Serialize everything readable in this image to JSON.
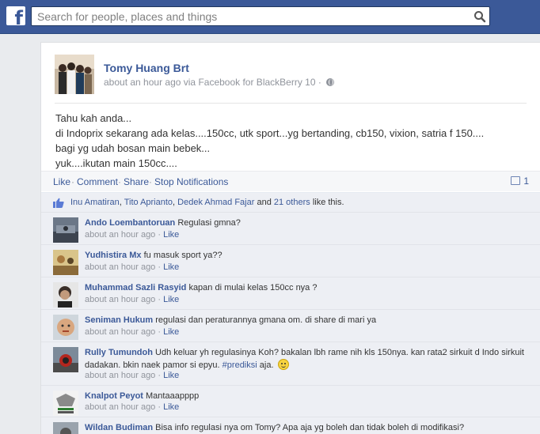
{
  "header": {
    "search_placeholder": "Search for people, places and things"
  },
  "post": {
    "author": "Tomy Huang Brt",
    "time": "about an hour ago",
    "via": "via Facebook for BlackBerry 10",
    "lines": [
      "Tahu kah anda...",
      "di Indoprix sekarang ada kelas....150cc, utk sport...yg bertanding, cb150, vixion, satria f 150....",
      "bagi yg udah bosan main bebek...",
      "yuk....ikutan main 150cc...."
    ]
  },
  "actions": {
    "like": "Like",
    "comment": "Comment",
    "share": "Share",
    "stop": "Stop Notifications",
    "comment_count": "1"
  },
  "likes": {
    "names": [
      "Inu Amatiran",
      "Tito Aprianto",
      "Dedek Ahmad Fajar"
    ],
    "and": "and",
    "others": "21 others",
    "suffix": "like this."
  },
  "comments": [
    {
      "name": "Ando Loembantoruan",
      "text": "Regulasi gmna?",
      "time": "about an hour ago",
      "like": "Like"
    },
    {
      "name": "Yudhistira Mx",
      "text": "fu masuk sport ya??",
      "time": "about an hour ago",
      "like": "Like"
    },
    {
      "name": "Muhammad Sazli Rasyid",
      "text": "kapan di mulai kelas 150cc nya ?",
      "time": "about an hour ago",
      "like": "Like"
    },
    {
      "name": "Seniman Hukum",
      "text": "regulasi dan peraturannya gmana om. di share di mari ya",
      "time": "about an hour ago",
      "like": "Like"
    },
    {
      "name": "Rully Tumundoh",
      "text": "Udh keluar yh regulasinya Koh? bakalan lbh rame nih kls 150nya. kan rata2 sirkuit d Indo sirkuit dadakan. bkin naek pamor si epyu.",
      "hashtag": "#prediksi",
      "text_after": "aja.",
      "time": "about an hour ago",
      "like": "Like"
    },
    {
      "name": "Knalpot Peyot",
      "text": "Mantaaapppp",
      "time": "about an hour ago",
      "like": "Like"
    },
    {
      "name": "Wildan Budiman",
      "text": "Bisa info regulasi nya om Tomy? Apa aja yg boleh dan tidak boleh di modifikasi?",
      "time": "",
      "like": ""
    }
  ],
  "colors": {
    "brand": "#3b5998",
    "link": "#3b5998",
    "comment_bg": "#edeff4"
  }
}
